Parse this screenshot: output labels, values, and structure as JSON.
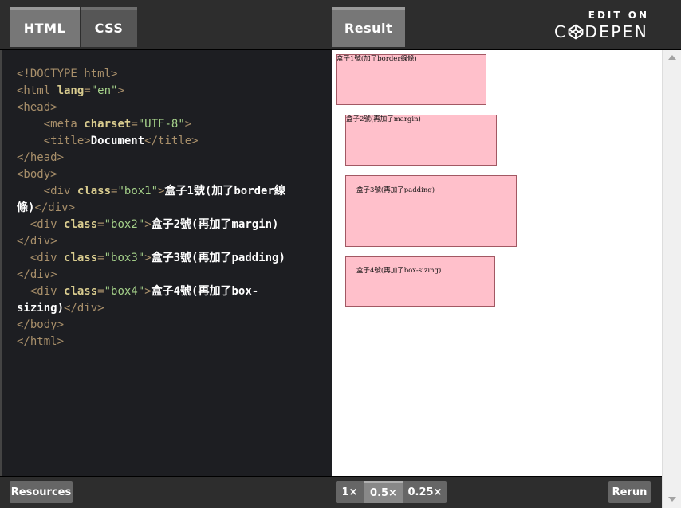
{
  "tabs": {
    "html": "HTML",
    "css": "CSS",
    "result": "Result"
  },
  "brand": {
    "edit_on": "EDIT ON",
    "codepen_prefix": "C",
    "codepen_suffix": "DEPEN",
    "logo_icon": "codepen-logo-icon"
  },
  "code_tokens": [
    [
      [
        "tg",
        "<!DOCTYPE html>"
      ]
    ],
    [
      [
        "tg",
        "<html "
      ],
      [
        "at",
        "lang"
      ],
      [
        "pl",
        "="
      ],
      [
        "vl",
        "\"en\""
      ],
      [
        "tg",
        ">"
      ]
    ],
    [
      [
        "tg",
        "<head>"
      ]
    ],
    [
      [
        "pl",
        "    "
      ],
      [
        "tg",
        "<meta "
      ],
      [
        "at",
        "charset"
      ],
      [
        "pl",
        "="
      ],
      [
        "vl",
        "\"UTF-8\""
      ],
      [
        "tg",
        ">"
      ]
    ],
    [
      [
        "pl",
        "    "
      ],
      [
        "tg",
        "<title>"
      ],
      [
        "tx",
        "Document"
      ],
      [
        "tg",
        "</title>"
      ]
    ],
    [
      [
        "tg",
        "</head>"
      ]
    ],
    [
      [
        "tg",
        "<body>"
      ]
    ],
    [
      [
        "pl",
        "    "
      ],
      [
        "tg",
        "<div "
      ],
      [
        "at",
        "class"
      ],
      [
        "pl",
        "="
      ],
      [
        "vl",
        "\"box1\""
      ],
      [
        "tg",
        ">"
      ],
      [
        "tx",
        "盒子1號(加了border線"
      ]
    ],
    [
      [
        "tx",
        "條)"
      ],
      [
        "tg",
        "</div>"
      ]
    ],
    [
      [
        "pl",
        "  "
      ],
      [
        "tg",
        "<div "
      ],
      [
        "at",
        "class"
      ],
      [
        "pl",
        "="
      ],
      [
        "vl",
        "\"box2\""
      ],
      [
        "tg",
        ">"
      ],
      [
        "tx",
        "盒子2號(再加了margin)"
      ]
    ],
    [
      [
        "tg",
        "</div>"
      ]
    ],
    [
      [
        "pl",
        "  "
      ],
      [
        "tg",
        "<div "
      ],
      [
        "at",
        "class"
      ],
      [
        "pl",
        "="
      ],
      [
        "vl",
        "\"box3\""
      ],
      [
        "tg",
        ">"
      ],
      [
        "tx",
        "盒子3號(再加了padding)"
      ]
    ],
    [
      [
        "tg",
        "</div>"
      ]
    ],
    [
      [
        "pl",
        "  "
      ],
      [
        "tg",
        "<div "
      ],
      [
        "at",
        "class"
      ],
      [
        "pl",
        "="
      ],
      [
        "vl",
        "\"box4\""
      ],
      [
        "tg",
        ">"
      ],
      [
        "tx",
        "盒子4號(再加了box-"
      ]
    ],
    [
      [
        "tx",
        "sizing)"
      ],
      [
        "tg",
        "</div>"
      ]
    ],
    [
      [
        "tg",
        "</body>"
      ]
    ],
    [
      [
        "tg",
        "</html>"
      ]
    ]
  ],
  "result": {
    "box1": "盒子1號(加了border線條)",
    "box2": "盒子2號(再加了margin)",
    "box3": "盒子3號(再加了padding)",
    "box4": "盒子4號(再加了box-sizing)",
    "box_color": "#ffc0cb",
    "box_border_color": "#a25863"
  },
  "footer": {
    "resources": "Resources",
    "zoom": [
      "1×",
      "0.5×",
      "0.25×"
    ],
    "zoom_selected": "0.5×",
    "rerun": "Rerun"
  }
}
